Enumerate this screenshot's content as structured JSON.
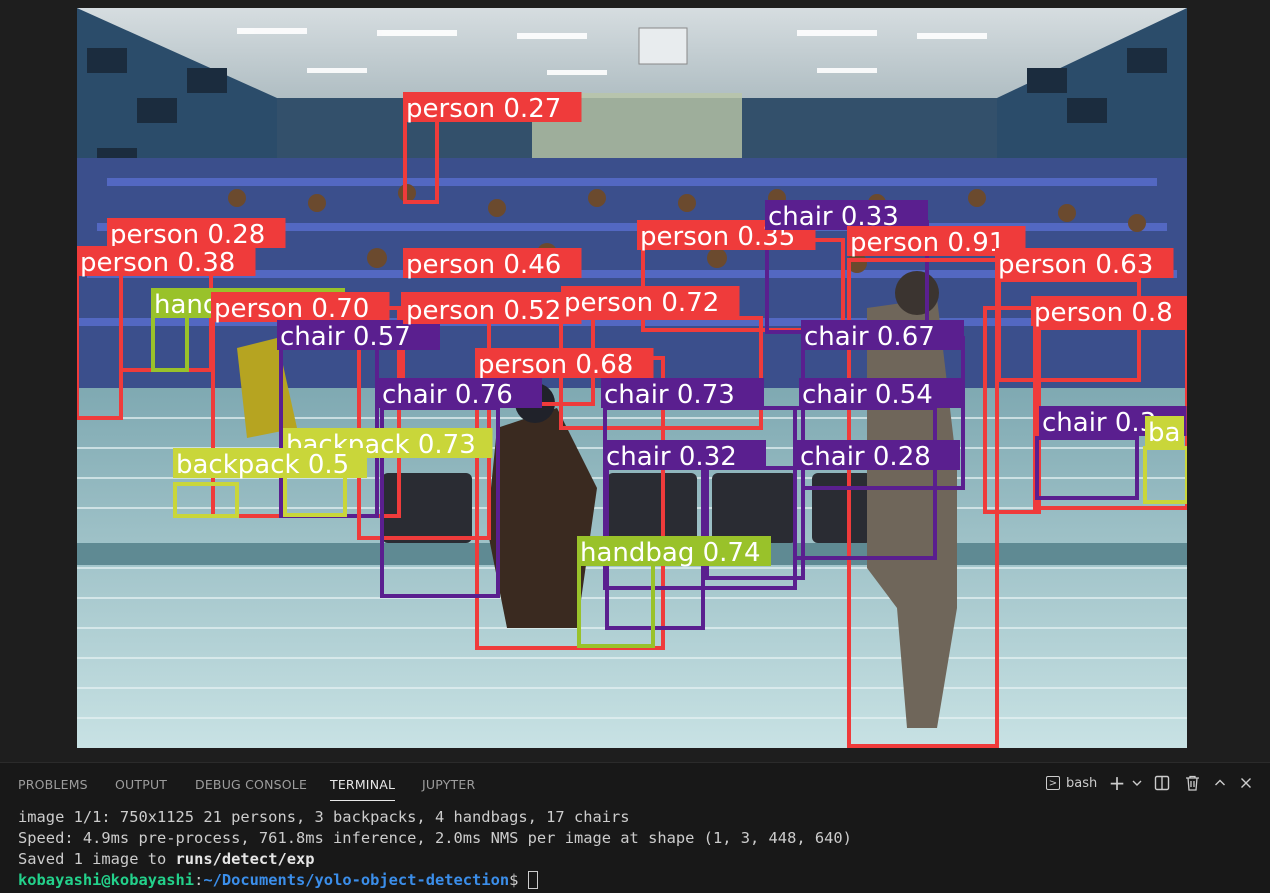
{
  "image": {
    "detections": [
      {
        "label": "person 0.27",
        "color": "#ef3b3b"
      },
      {
        "label": "person 0.28",
        "color": "#ef3b3b"
      },
      {
        "label": "person 0.38",
        "color": "#ef3b3b"
      },
      {
        "label": "handbag 0.35",
        "color": "#99c22a"
      },
      {
        "label": "person 0.70",
        "color": "#ef3b3b"
      },
      {
        "label": "chair 0.57",
        "color": "#5a1f8f"
      },
      {
        "label": "person 0.46",
        "color": "#ef3b3b"
      },
      {
        "label": "person 0.52",
        "color": "#ef3b3b"
      },
      {
        "label": "person 0.35",
        "color": "#ef3b3b"
      },
      {
        "label": "chair 0.33",
        "color": "#5a1f8f"
      },
      {
        "label": "person 0.91",
        "color": "#ef3b3b"
      },
      {
        "label": "person 0.63",
        "color": "#ef3b3b"
      },
      {
        "label": "person 0.8",
        "color": "#ef3b3b"
      },
      {
        "label": "person 0.72",
        "color": "#ef3b3b"
      },
      {
        "label": "person 0.68",
        "color": "#ef3b3b"
      },
      {
        "label": "chair 0.67",
        "color": "#5a1f8f"
      },
      {
        "label": "chair 0.76",
        "color": "#5a1f8f"
      },
      {
        "label": "chair 0.73",
        "color": "#5a1f8f"
      },
      {
        "label": "chair 0.54",
        "color": "#5a1f8f"
      },
      {
        "label": "chair 0.32",
        "color": "#5a1f8f"
      },
      {
        "label": "chair 0.28",
        "color": "#5a1f8f"
      },
      {
        "label": "chair 0.3",
        "color": "#5a1f8f"
      },
      {
        "label": "backpack 0.73",
        "color": "#c9d63a"
      },
      {
        "label": "backpack 0.5",
        "color": "#c9d63a"
      },
      {
        "label": "handbag 0.74",
        "color": "#99c22a"
      },
      {
        "label": "ba",
        "color": "#c9d63a"
      }
    ]
  },
  "panel": {
    "tabs": [
      "PROBLEMS",
      "OUTPUT",
      "DEBUG CONSOLE",
      "TERMINAL",
      "JUPYTER"
    ],
    "active_tab": "TERMINAL",
    "shell_label": "bash",
    "icons": [
      "terminal-icon",
      "add-icon",
      "chevron-down-icon",
      "split-icon",
      "trash-icon",
      "chevron-up-icon",
      "close-icon"
    ]
  },
  "terminal": {
    "line1": "image 1/1: 750x1125 21 persons, 3 backpacks, 4 handbags, 17 chairs",
    "line2": "Speed: 4.9ms pre-process, 761.8ms inference, 2.0ms NMS per image at shape (1, 3, 448, 640)",
    "line3_prefix": "Saved 1 image to ",
    "line3_path": "runs/detect/exp",
    "prompt_user": "kobayashi@kobayashi",
    "prompt_sep": ":",
    "prompt_path": "~/Documents/yolo-object-detection",
    "prompt_symbol": "$ "
  }
}
